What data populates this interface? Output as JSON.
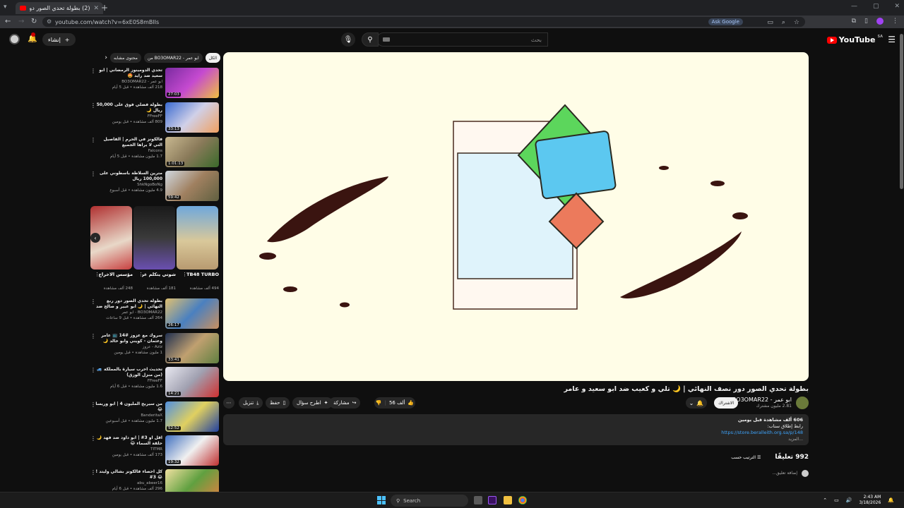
{
  "browser": {
    "tab_title": "(2) بطولة تحدي الصور دور نصف",
    "url": "youtube.com/watch?v=6xE0S8mBlIs",
    "ask_google": "Ask Google"
  },
  "masthead": {
    "logo": "YouTube",
    "country": "SA",
    "search_placeholder": "بحث",
    "create_label": "إنشاء"
  },
  "video": {
    "title": "بطولة تحدي الصور دور نصف النهائي | 🌙 تلي و كعيب ضد ابو سعيد و عامر",
    "channel_name": "ابو عمر - BO3OMAR22",
    "channel_subs": "2.81 مليون مشترك",
    "subscribe": "الاشتراك",
    "likes": "56 ألف",
    "share": "مشاركة",
    "ask": "اطرح سؤال",
    "save": "حفظ",
    "download": "تنزيل"
  },
  "description": {
    "stats": "606 ألف مشاهدة قبل يومين",
    "line2": "رابط إطلاق سناب:",
    "link": "https://store.beralleith.org.sa/p/148",
    "more": "...المزيد"
  },
  "comments": {
    "count": "992 تعليقًا",
    "sort": "الترتيب حسب",
    "placeholder": "إضافة تعليق..."
  },
  "chips": [
    {
      "label": "الكل"
    },
    {
      "label": "من BO3OMAR22 - ابو عمر"
    },
    {
      "label": "محتوى مشابه"
    }
  ],
  "recommendations": [
    {
      "title": "تحدي الدومينوز الرمضاني | ابو سعيد ضد رايد 🤩",
      "channel": "ابو عمر - BO3OMAR22",
      "meta": "218 ألف مشاهدة • قبل 5 أيام",
      "duration": "27:03"
    },
    {
      "title": "بطولة فضلي فوق على 50,000 ريال 🌙",
      "channel": "FFreeFF",
      "meta": "809 ألف مشاهدة • قبل يومين",
      "duration": "33:13"
    },
    {
      "title": "فالكونز في الحرم | الفاصيل التي لا يراها الجميع",
      "channel": "Falcons",
      "meta": "1.7 مليون مشاهدة • قبل 5 أيام",
      "duration": "1:01:13"
    },
    {
      "title": "مترين السلاطة باسطوني على 100,000 ريال",
      "channel": "ShkNgoBoNg",
      "meta": "4.9 مليون مشاهدة • قبل أسبوع",
      "duration": "59:42"
    },
    {
      "title": "بطولة تحدي الصور دور ربع النهائي | 🌙 ابو عبير و صالح ضد كويني و عثمان",
      "channel": "BO3OMAR22 - ابو عمر",
      "meta": "264 ألف مشاهدة • قبل 9 ساعات",
      "duration": "26:17"
    },
    {
      "title": "سروك مع عزوز #14 📺 عامر وعثمان - كويني وابو خالد 🌙 الموسم الثالث",
      "channel": "Aziz - عزوز",
      "meta": "1 مليون مشاهدة • قبل يومين",
      "duration": "33:41"
    },
    {
      "title": "تحديث اخرب سيارة بالمملكة 🚙 (من منزل الوزق)",
      "channel": "FFreeFF",
      "meta": "1.6 مليون مشاهدة • قبل 6 أيام",
      "duration": "14:21"
    },
    {
      "title": "من سيربح المليون 4 | ابو وريسا 😂",
      "channel": "BanderitaX",
      "meta": "1.7 مليون مشاهدة • قبل أسبوعين",
      "duration": "52:52"
    },
    {
      "title": "اقل او 3# | ابو داود ضد فهد 🌙 حلقة السماء 😂",
      "channel": "TITMR",
      "meta": "173 ألف مشاهدة • قبل يومين",
      "duration": "19:32"
    },
    {
      "title": "كل احصاء فالكونز بشالي وليتد ! 😂 3#",
      "channel": "abu_abeer16",
      "meta": "296 ألف مشاهدة • قبل 6 أيام",
      "duration": ""
    }
  ],
  "shorts": [
    {
      "title": "TB48 TURBO 🔥",
      "views": "494 ألف مشاهدة"
    },
    {
      "title": "شوتي يتكلم عن مشاركته ف...",
      "views": "181 ألف مشاهدة"
    },
    {
      "title": "مؤسس الاخراج ...",
      "views": "248 ألف مشاهدة"
    }
  ],
  "taskbar": {
    "search": "Search",
    "time": "2:43 AM",
    "date": "3/18/2026"
  },
  "colors": {
    "accent_red": "#ff0000",
    "video_bg": "#fffde7",
    "link": "#3ea6ff"
  }
}
